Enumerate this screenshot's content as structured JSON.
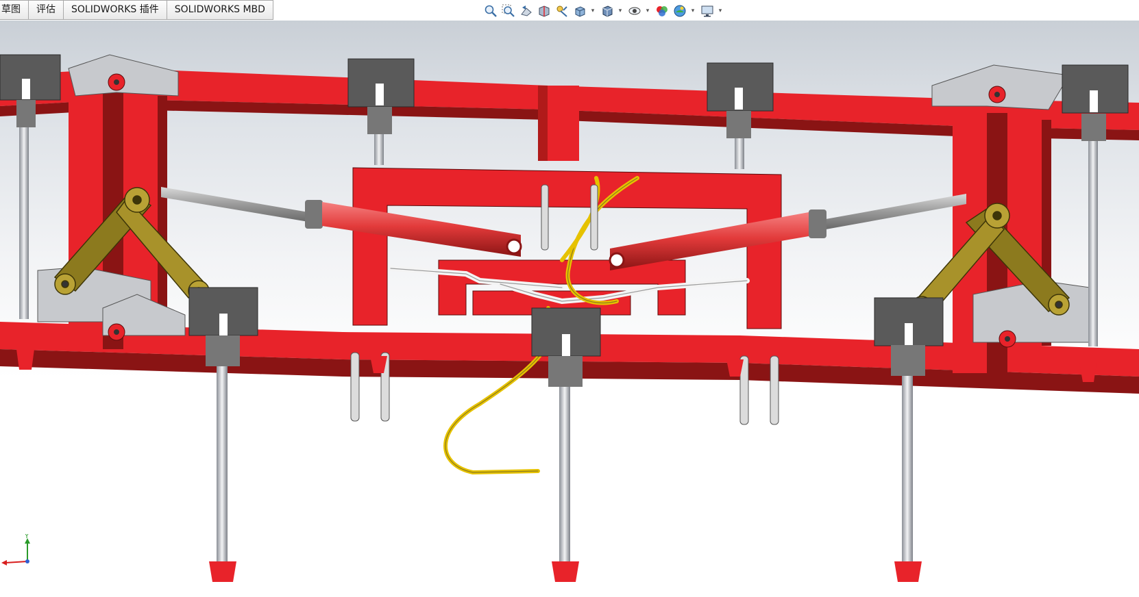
{
  "tabs": [
    {
      "label": "草图"
    },
    {
      "label": "评估"
    },
    {
      "label": "SOLIDWORKS 插件"
    },
    {
      "label": "SOLIDWORKS MBD"
    }
  ],
  "hud_toolbar": {
    "buttons": [
      {
        "icon": "zoom-to-fit-icon"
      },
      {
        "icon": "zoom-to-area-icon"
      },
      {
        "icon": "previous-view-icon"
      },
      {
        "icon": "section-view-icon"
      },
      {
        "icon": "dynamic-annotation-views-icon"
      },
      {
        "icon": "view-orientation-icon",
        "dropdown": true
      },
      {
        "icon": "display-style-icon",
        "dropdown": true
      },
      {
        "icon": "hide-show-items-icon",
        "dropdown": true
      },
      {
        "icon": "edit-appearance-icon"
      },
      {
        "icon": "apply-scene-icon",
        "dropdown": true
      },
      {
        "icon": "view-settings-icon",
        "dropdown": true
      }
    ]
  },
  "triad": {
    "y_label": "Y"
  },
  "colors": {
    "frame_red": "#e8232a",
    "frame_dark": "#8a1414",
    "tine_gray": "#5a5a5a",
    "linkage_gold": "#8c7a1e",
    "hose_yellow": "#e6c200",
    "cylinder_red": "#e23a3a"
  }
}
